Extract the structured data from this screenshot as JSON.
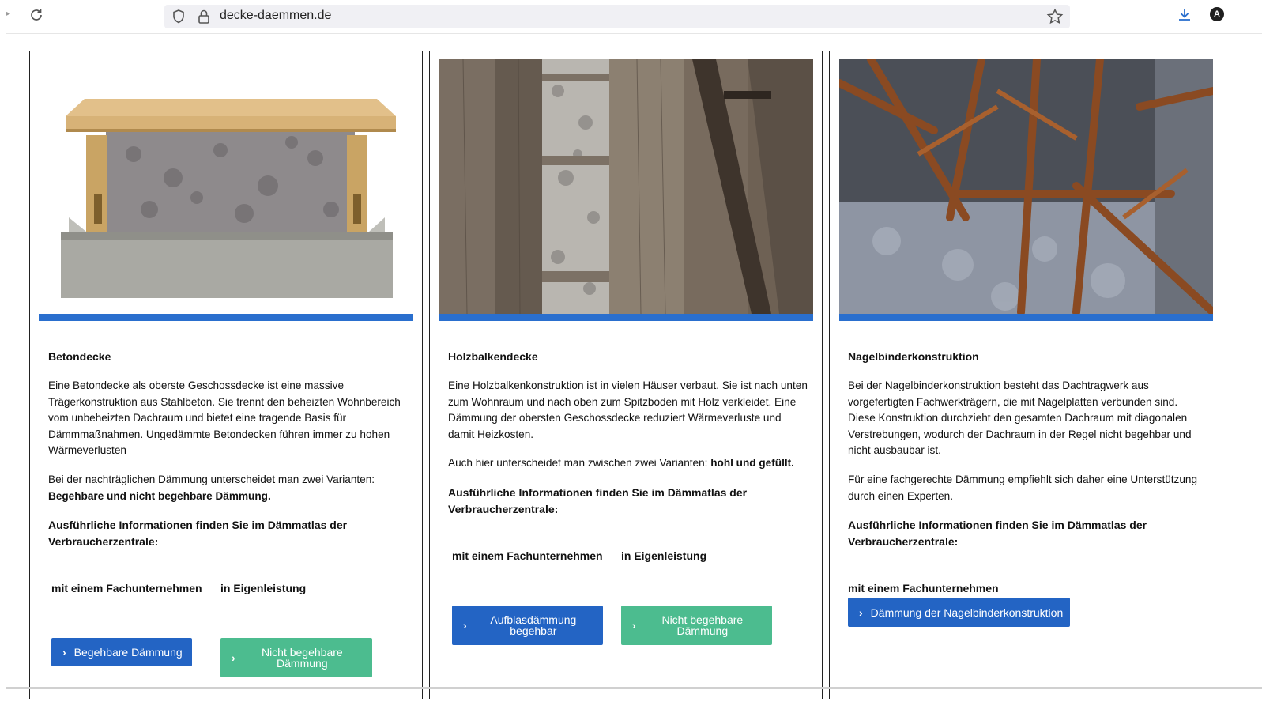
{
  "browser": {
    "url": "decke-daemmen.de",
    "avatar_letter": "A"
  },
  "cards": [
    {
      "title": "Betondecke",
      "paragraph1": "Eine Betondecke als oberste Geschossdecke ist eine massive Trägerkonstruktion aus Stahlbeton. Sie trennt den beheizten Wohnbereich vom unbeheizten Dachraum und bietet eine tragende Basis für Dämmmaßnahmen. Ungedämmte Betondecken führen immer zu hohen Wärmeverlusten",
      "paragraph2_text": "Bei der nachträglichen Dämmung unterscheidet man zwei Varianten:",
      "paragraph2_bold": "Begehbare und nicht begehbare Dämmung.",
      "info": "Ausführliche Informationen finden Sie im Dämmatlas der Verbraucherzentrale:",
      "label_left": "mit einem Fachunternehmen",
      "label_right": "in Eigenleistung",
      "button_left": "Begehbare Dämmung",
      "button_right": "Nicht begehbare Dämmung"
    },
    {
      "title": "Holzbalkendecke",
      "paragraph1": "Eine Holzbalkenkonstruktion ist in vielen Häuser verbaut. Sie ist nach unten zum Wohnraum und nach oben zum Spitzboden mit Holz verkleidet. Eine Dämmung der obersten Geschossdecke reduziert Wärmeverluste und damit Heizkosten.",
      "paragraph2_text": "Auch hier unterscheidet man zwischen zwei Varianten:",
      "paragraph2_bold": "hohl und gefüllt.",
      "info": "Ausführliche Informationen finden Sie im Dämmatlas der Verbraucherzentrale:",
      "label_left": "mit einem Fachunternehmen",
      "label_right": "in Eigenleistung",
      "button_left": "Aufblasdämmung begehbar",
      "button_right": "Nicht begehbare Dämmung"
    },
    {
      "title": "Nagelbinderkonstruktion",
      "paragraph1": "Bei der Nagelbinderkonstruktion besteht das Dachtragwerk aus vorgefertigten Fachwerkträgern, die mit Nagelplatten verbunden sind. Diese Konstruktion durchzieht den gesamten Dachraum mit diagonalen Verstrebungen, wodurch der Dachraum in der Regel nicht begehbar und nicht ausbaubar ist.",
      "paragraph2_text": "Für eine fachgerechte Dämmung empfiehlt sich daher eine Unterstützung durch einen Experten.",
      "info": "Ausführliche Informationen finden Sie im Dämmatlas der Verbraucherzentrale:",
      "label_left": "mit einem Fachunternehmen",
      "button_left": "Dämmung der Nagelbinderkonstruktion"
    }
  ],
  "colors": {
    "accent_blue": "#2a6fce",
    "button_blue": "#2364c4",
    "button_green": "#4cbc8f"
  }
}
